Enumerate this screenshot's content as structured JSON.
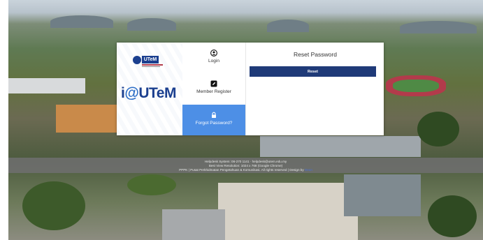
{
  "brand": {
    "logo_text": "UTeM",
    "title_i": "i",
    "title_at": "@",
    "title_rest": "UTeM"
  },
  "menu": {
    "items": [
      {
        "label": "Login",
        "icon": "user-circle-icon"
      },
      {
        "label": "Member Register",
        "icon": "edit-icon"
      },
      {
        "label": "Forgot Password?",
        "icon": "lock-icon",
        "active": true
      }
    ]
  },
  "panel": {
    "title": "Reset Password",
    "button_label": "Reset"
  },
  "footer": {
    "line1": "Helpdesk System: 06-270 1141 · helpdesk@utem.edu.my",
    "line2": "Best View Resolution: 1024 x 768 (Google Chrome)",
    "line3": "PPPK | Pusat Perkhidmatan Pengetahuan & Komunikasi. All rights reserved | Design by",
    "credit": "Deon"
  },
  "colors": {
    "brand_blue": "#1f3a78",
    "active_blue": "#4d8fe6"
  }
}
